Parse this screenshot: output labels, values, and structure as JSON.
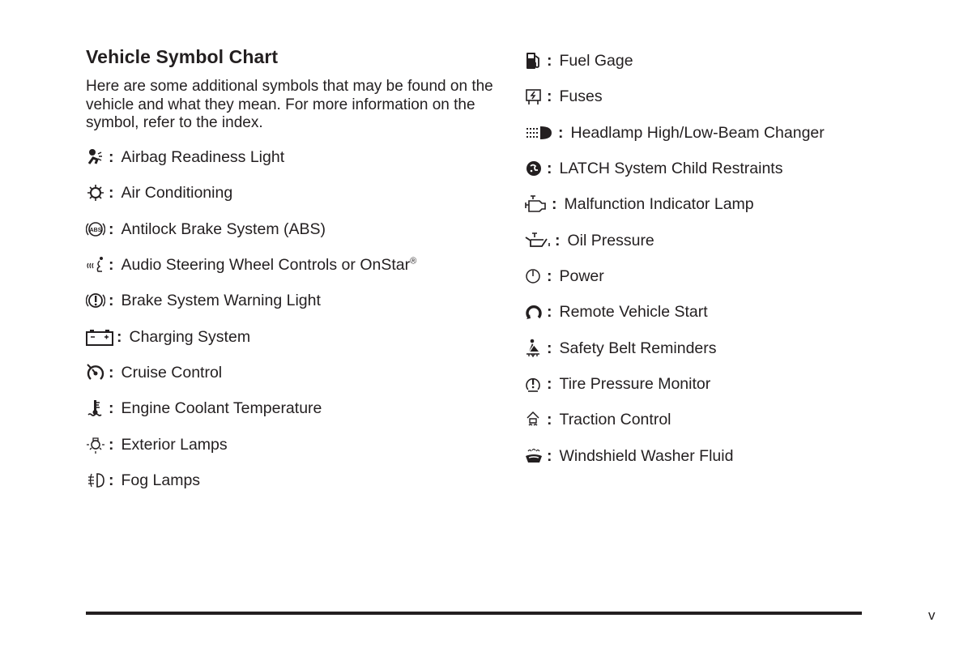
{
  "page": {
    "title": "Vehicle Symbol Chart",
    "intro": "Here are some additional symbols that may be found on the vehicle and what they mean. For more information on the symbol, refer to the index.",
    "separator": ":",
    "page_number": "v"
  },
  "left_column": [
    {
      "icon": "airbag-icon",
      "label": "Airbag Readiness Light"
    },
    {
      "icon": "air-conditioning-icon",
      "label": "Air Conditioning"
    },
    {
      "icon": "abs-icon",
      "label": "Antilock Brake System (ABS)"
    },
    {
      "icon": "audio-steering-icon",
      "label": "Audio Steering Wheel Controls or OnStar",
      "sup": "®"
    },
    {
      "icon": "brake-warning-icon",
      "label": "Brake System Warning Light"
    },
    {
      "icon": "battery-icon",
      "label": "Charging System"
    },
    {
      "icon": "cruise-control-icon",
      "label": "Cruise Control"
    },
    {
      "icon": "coolant-temperature-icon",
      "label": "Engine Coolant Temperature"
    },
    {
      "icon": "exterior-lamps-icon",
      "label": "Exterior Lamps"
    },
    {
      "icon": "fog-lamps-icon",
      "label": "Fog Lamps"
    }
  ],
  "right_column": [
    {
      "icon": "fuel-pump-icon",
      "label": "Fuel Gage"
    },
    {
      "icon": "fuses-icon",
      "label": "Fuses"
    },
    {
      "icon": "headlamp-beam-icon",
      "label": "Headlamp High/Low-Beam Changer"
    },
    {
      "icon": "child-seat-icon",
      "label": "LATCH System Child Restraints"
    },
    {
      "icon": "engine-icon",
      "label": "Malfunction Indicator Lamp"
    },
    {
      "icon": "oil-can-icon",
      "label": "Oil Pressure"
    },
    {
      "icon": "power-icon",
      "label": "Power"
    },
    {
      "icon": "remote-start-icon",
      "label": "Remote Vehicle Start"
    },
    {
      "icon": "seat-belt-icon",
      "label": "Safety Belt Reminders"
    },
    {
      "icon": "tire-pressure-icon",
      "label": "Tire Pressure Monitor"
    },
    {
      "icon": "traction-control-icon",
      "label": "Traction Control"
    },
    {
      "icon": "washer-fluid-icon",
      "label": "Windshield Washer Fluid"
    }
  ]
}
